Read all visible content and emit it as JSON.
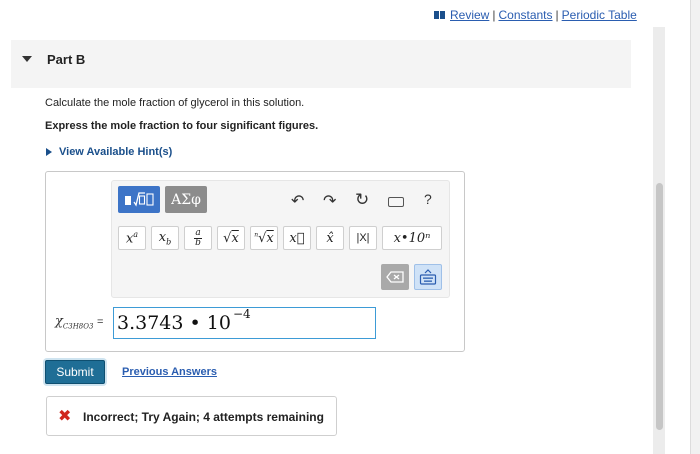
{
  "top_links": {
    "review": "Review",
    "constants": "Constants",
    "periodic_table": "Periodic Table",
    "separator": "|"
  },
  "part": {
    "title": "Part B",
    "question": "Calculate the mole fraction of glycerol in this solution.",
    "instruction": "Express the mole fraction to four significant figures.",
    "hint_label": "View Available Hint(s)"
  },
  "toolbar": {
    "greek_label": "ΑΣφ",
    "help_label": "?",
    "abs_label": "|X|",
    "sci_label": "x•10ⁿ"
  },
  "answer": {
    "variable_symbol": "χ",
    "variable_sub": "C3H8O3",
    "equals": "=",
    "mantissa": "3.3743 • 10",
    "exponent": "−4"
  },
  "actions": {
    "submit_label": "Submit",
    "previous_answers_label": "Previous Answers"
  },
  "feedback": {
    "icon": "✖",
    "message": "Incorrect; Try Again; 4 attempts remaining"
  },
  "colors": {
    "link": "#2a5db0",
    "submit_bg": "#1f6e96",
    "error": "#d0271d",
    "template_button": "#3d74c7"
  }
}
